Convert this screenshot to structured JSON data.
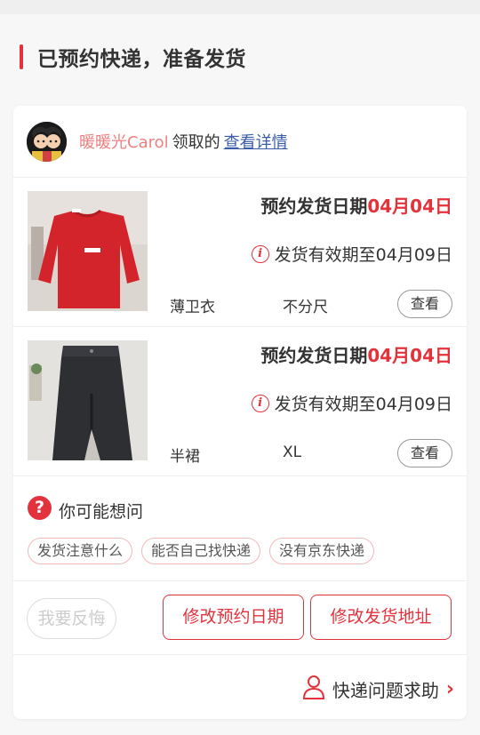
{
  "header": {
    "title": "已预约快递，准备发货"
  },
  "receiver": {
    "name": "暖暖光Carol",
    "action": "领取的",
    "detail_link": "查看详情"
  },
  "items": [
    {
      "date_label": "预约发货日期",
      "date": "04月04日",
      "valid_text": "发货有效期至04月09日",
      "name": "薄卫衣",
      "size": "不分尺",
      "view_label": "查看"
    },
    {
      "date_label": "预约发货日期",
      "date": "04月04日",
      "valid_text": "发货有效期至04月09日",
      "name": "半裙",
      "size": "XL",
      "view_label": "查看"
    }
  ],
  "faq": {
    "title": "你可能想问",
    "chips": [
      "发货注意什么",
      "能否自己找快递",
      "没有京东快递"
    ]
  },
  "actions": {
    "regret": "我要反悔",
    "modify_date": "修改预约日期",
    "modify_address": "修改发货地址"
  },
  "help": {
    "label": "快递问题求助"
  },
  "colors": {
    "accent": "#e2333d",
    "link": "#3a5ca8",
    "receiver_name": "#f08080"
  },
  "icons": {
    "info": "info-icon",
    "question": "question-icon",
    "user": "user-icon",
    "chevron": "chevron-right-icon"
  }
}
